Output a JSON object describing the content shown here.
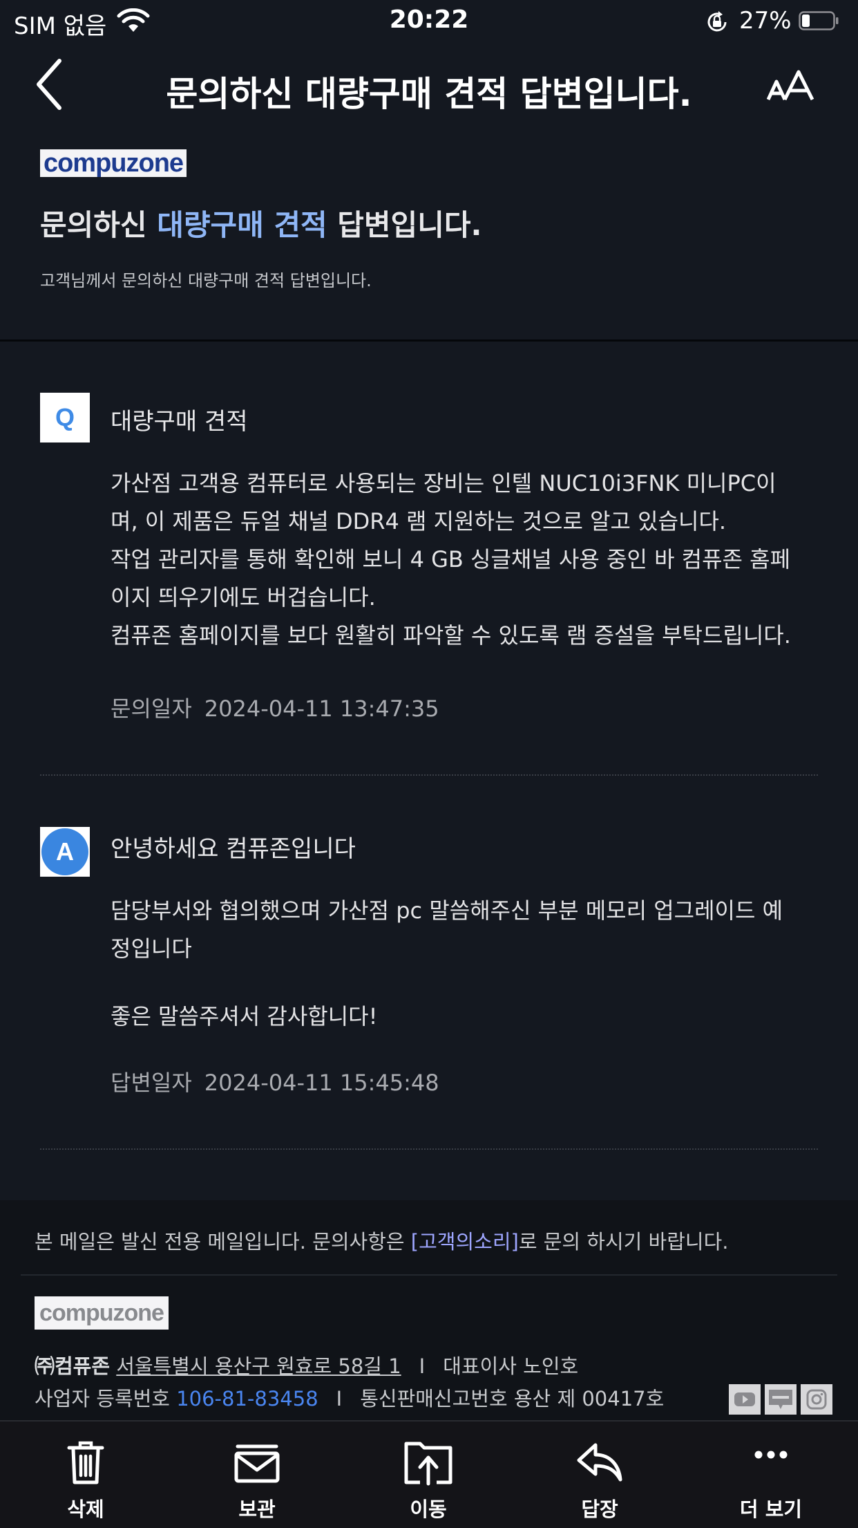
{
  "status_bar": {
    "carrier": "SIM 없음",
    "time": "20:22",
    "battery_percent": "27%",
    "icons": [
      "wifi-icon",
      "orientation-lock-icon",
      "battery-icon"
    ]
  },
  "nav": {
    "title": "문의하신 대량구매 견적 답변입니다.",
    "icons": [
      "back-chevron-icon",
      "text-size-icon"
    ]
  },
  "email": {
    "logo_text": "compuzone",
    "headline_prefix": "문의하신",
    "headline_highlight": "대량구매 견적",
    "headline_suffix": "답변입니다.",
    "sub_description": "고객님께서 문의하신 대량구매 견적 답변입니다.",
    "question": {
      "badge": "Q",
      "title": "대량구매 견적",
      "lines": [
        "가산점 고객용 컴퓨터로 사용되는 장비는 인텔 NUC10i3FNK 미니PC이",
        "며, 이 제품은 듀얼 채널 DDR4 램 지원하는 것으로 알고 있습니다.",
        "작업 관리자를 통해 확인해 보니 4 GB 싱글채널 사용 중인 바 컴퓨존 홈페",
        "이지 띄우기에도 버겁습니다.",
        "컴퓨존 홈페이지를 보다 원활히 파악할 수 있도록 램 증설을 부탁드립니다."
      ],
      "date_label": "문의일자",
      "date_value": "2024-04-11 13:47:35"
    },
    "answer": {
      "badge": "A",
      "title": "안녕하세요 컴퓨존입니다",
      "lines": [
        "담당부서와 협의했으며 가산점 pc 말씀해주신 부분 메모리 업그레이드 예",
        "정입니다",
        "",
        "좋은 말씀주셔서 감사합니다!"
      ],
      "date_label": "답변일자",
      "date_value": "2024-04-11 15:45:48"
    }
  },
  "footer": {
    "notice_prefix": "본 메일은 발신 전용 메일입니다. 문의사항은",
    "notice_link": "[고객의소리]",
    "notice_suffix": "로 문의 하시기 바랍니다.",
    "logo_text": "compuzone",
    "company": "㈜컴퓨존",
    "address": "서울특별시 용산구 원효로 58길 1",
    "separator": "I",
    "ceo": "대표이사 노인호",
    "reg_label": "사업자 등록번호",
    "reg_number": "106-81-83458",
    "mail_order": "통신판매신고번호 용산 제 00417호",
    "social_icons": [
      "youtube-icon",
      "blog-icon",
      "instagram-icon"
    ]
  },
  "toolbar": {
    "items": [
      {
        "label": "삭제",
        "icon": "trash-icon"
      },
      {
        "label": "보관",
        "icon": "archive-icon"
      },
      {
        "label": "이동",
        "icon": "move-folder-icon"
      },
      {
        "label": "답장",
        "icon": "reply-icon"
      },
      {
        "label": "더 보기",
        "icon": "more-icon"
      }
    ]
  }
}
